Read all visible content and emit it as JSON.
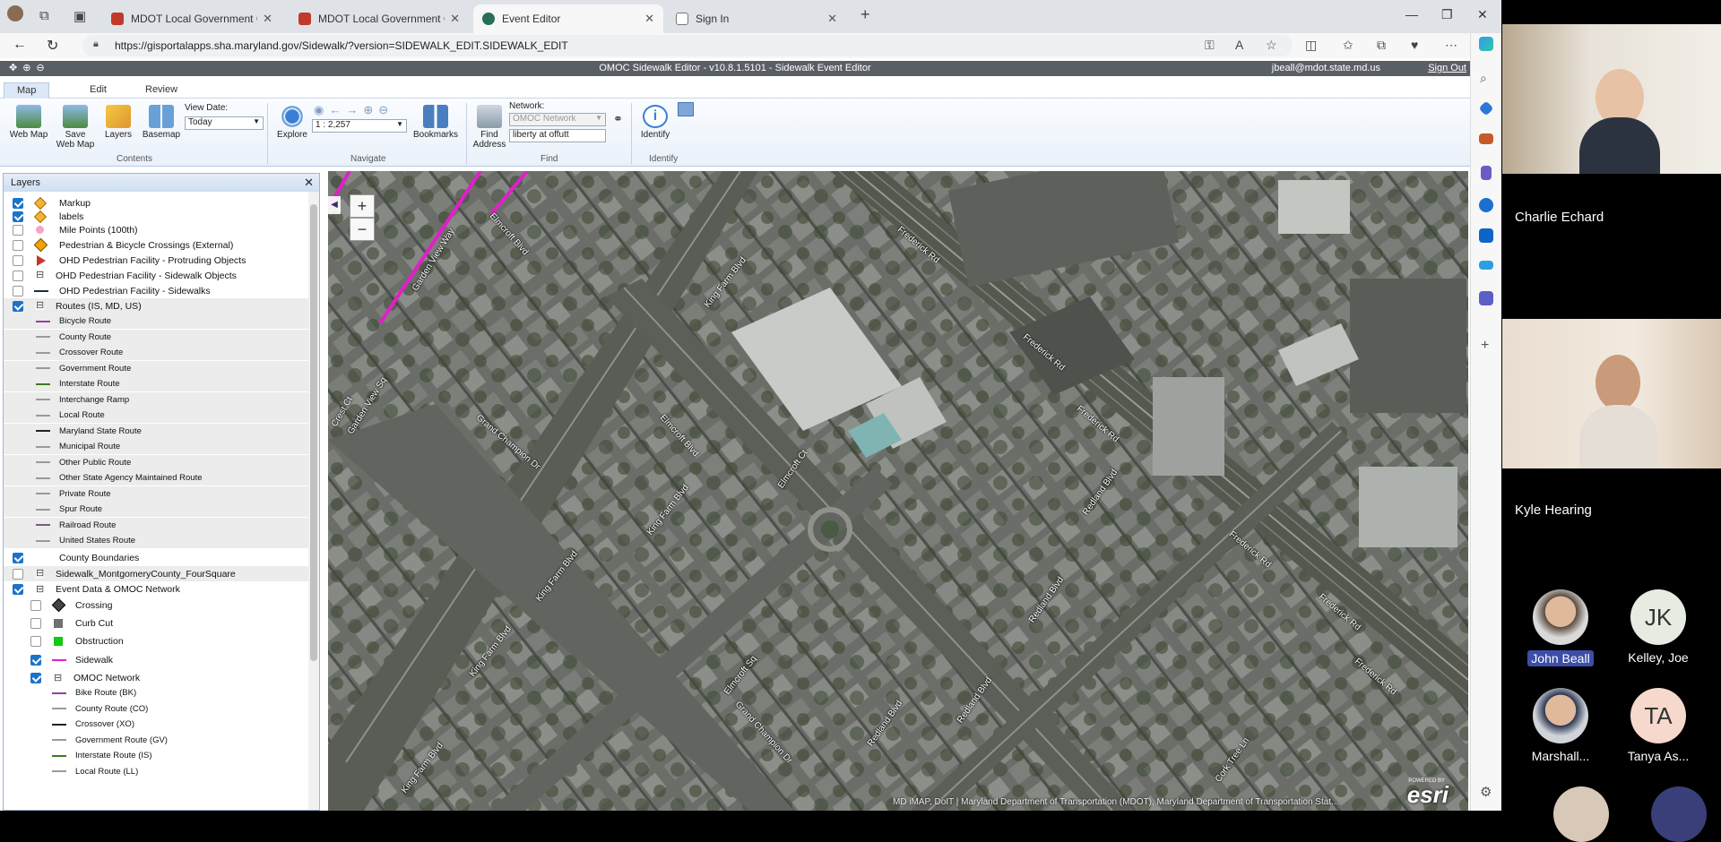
{
  "browser": {
    "tabs": [
      {
        "title": "MDOT Local Government Coordin",
        "close": "✕"
      },
      {
        "title": "MDOT Local Government Coordin",
        "close": "✕"
      },
      {
        "title": "Event Editor",
        "close": "✕"
      },
      {
        "title": "Sign In",
        "close": "✕"
      }
    ],
    "new_tab": "+",
    "url": "https://gisportalapps.sha.maryland.gov/Sidewalk/?version=SIDEWALK_EDIT.SIDEWALK_EDIT"
  },
  "app": {
    "title": "OMOC Sidewalk Editor - v10.8.1.5101 - Sidewalk Event Editor",
    "user": "jbeall@mdot.state.md.us",
    "sign_out": "Sign Out",
    "ribbon_tabs": [
      "Map",
      "Edit",
      "Review"
    ],
    "ribbon": {
      "web_map": "Web Map",
      "save_web_map": "Save Web Map",
      "layers": "Layers",
      "basemap": "Basemap",
      "view_date_label": "View Date:",
      "view_date_value": "Today",
      "contents_group": "Contents",
      "explore": "Explore",
      "scale": "1 : 2,257",
      "bookmarks": "Bookmarks",
      "navigate_group": "Navigate",
      "find_address": "Find Address",
      "network_label": "Network:",
      "network_value": "OMOC Network",
      "find_value": "liberty at offutt",
      "find_group": "Find",
      "identify": "Identify",
      "identify_group": "Identify"
    }
  },
  "layers_panel": {
    "title": "Layers",
    "close": "✕",
    "items": [
      {
        "label": "Markup",
        "checked": true,
        "symbol": "diamond-orange"
      },
      {
        "label": "labels",
        "checked": true,
        "symbol": "diamond-orange"
      },
      {
        "label": "Mile Points (100th)",
        "checked": false,
        "symbol": "dot-pink"
      },
      {
        "label": "Pedestrian & Bicycle Crossings (External)",
        "checked": false,
        "symbol": "diamond-warning"
      },
      {
        "label": "OHD Pedestrian Facility - Protruding Objects",
        "checked": false,
        "symbol": "triangle-red"
      },
      {
        "label": "OHD Pedestrian Facility - Sidewalk Objects",
        "checked": false,
        "symbol": "expand"
      },
      {
        "label": "OHD Pedestrian Facility - Sidewalks",
        "checked": false,
        "symbol": "line-navy"
      },
      {
        "label": "Routes (IS, MD, US)",
        "checked": true,
        "symbol": "expand"
      }
    ],
    "routes": [
      {
        "label": "Bicycle Route",
        "color": "#9c3d9c"
      },
      {
        "label": "County Route",
        "color": "#9a9a9a"
      },
      {
        "label": "Crossover Route",
        "color": "#9a9a9a"
      },
      {
        "label": "Government Route",
        "color": "#9a9a9a"
      },
      {
        "label": "Interstate Route",
        "color": "#3e7a1c"
      },
      {
        "label": "Interchange Ramp",
        "color": "#9a9a9a"
      },
      {
        "label": "Local Route",
        "color": "#9a9a9a"
      },
      {
        "label": "Maryland State Route",
        "color": "#222222"
      },
      {
        "label": "Municipal Route",
        "color": "#9a9a9a"
      },
      {
        "label": "Other Public Route",
        "color": "#9a9a9a"
      },
      {
        "label": "Other State Agency Maintained Route",
        "color": "#9a9a9a"
      },
      {
        "label": "Private Route",
        "color": "#9a9a9a"
      },
      {
        "label": "Spur Route",
        "color": "#9a9a9a"
      },
      {
        "label": "Railroad Route",
        "color": "#7a5a7a"
      },
      {
        "label": "United States Route",
        "color": "#9a9a9a"
      }
    ],
    "items2": [
      {
        "label": "County Boundaries",
        "checked": true
      },
      {
        "label": "Sidewalk_MontgomeryCounty_FourSquare",
        "checked": false
      },
      {
        "label": "Event Data & OMOC Network",
        "checked": true
      }
    ],
    "event_items": [
      {
        "label": "Crossing",
        "checked": false,
        "symbol": "diamond-black"
      },
      {
        "label": "Curb Cut",
        "checked": false,
        "symbol": "square-gray"
      },
      {
        "label": "Obstruction",
        "checked": false,
        "symbol": "square-green"
      },
      {
        "label": "Sidewalk",
        "checked": true,
        "symbol": "line-magenta"
      },
      {
        "label": "OMOC Network",
        "checked": true,
        "symbol": "expand"
      }
    ],
    "omoc_routes": [
      {
        "label": "Bike Route (BK)",
        "color": "#9c3d9c"
      },
      {
        "label": "County Route (CO)",
        "color": "#9a9a9a"
      },
      {
        "label": "Crossover (XO)",
        "color": "#222222"
      },
      {
        "label": "Government Route (GV)",
        "color": "#9a9a9a"
      },
      {
        "label": "Interstate Route (IS)",
        "color": "#3e7a1c"
      },
      {
        "label": "Local Route (LL)",
        "color": "#9a9a9a"
      }
    ]
  },
  "map": {
    "zoom_in": "+",
    "zoom_out": "−",
    "attribution": "MD iMAP, DoIT | Maryland Department of Transportation (MDOT), Maryland Department of Transportation Stat...",
    "esri_small": "POWERED BY",
    "esri": "esri",
    "labels": {
      "r1": "Frederick Rd",
      "r2": "Frederick Rd",
      "r3": "Frederick Rd",
      "r4": "Frederick Rd",
      "r5": "Frederick Rd",
      "r6": "Frederick Rd",
      "r7": "King Farm Blvd",
      "r8": "King Farm Blvd",
      "r9": "King Farm Blvd",
      "r10": "King Farm Blvd",
      "r11": "King Farm Blvd",
      "r12": "Elmcroft Blvd",
      "r13": "Elmcroft Blvd",
      "r14": "Elmcroft Ct",
      "r15": "Elmcroft Sq",
      "r16": "Grand Champion Dr",
      "r17": "Grand Champion Dr",
      "r18": "Garden View Way",
      "r19": "Garden View Sq",
      "r20": "Redland Blvd",
      "r21": "Redland Blvd",
      "r22": "Redland Blvd",
      "r23": "Redland Blvd",
      "r24": "Cork Tree Ln",
      "r25": "Crest Ct"
    }
  },
  "meeting": {
    "participants": [
      {
        "name": "Charlie Echard"
      },
      {
        "name": "Kyle Hearing"
      }
    ],
    "attendees": [
      {
        "name": "John Beall",
        "initials": ""
      },
      {
        "name": "Kelley, Joe",
        "initials": "JK"
      },
      {
        "name": "Marshall...",
        "initials": ""
      },
      {
        "name": "Tanya As...",
        "initials": "TA"
      }
    ]
  },
  "colors": {
    "accent": "#1a73c9",
    "sidewalk": "#e020c8",
    "title_bar": "#5a5f66"
  }
}
